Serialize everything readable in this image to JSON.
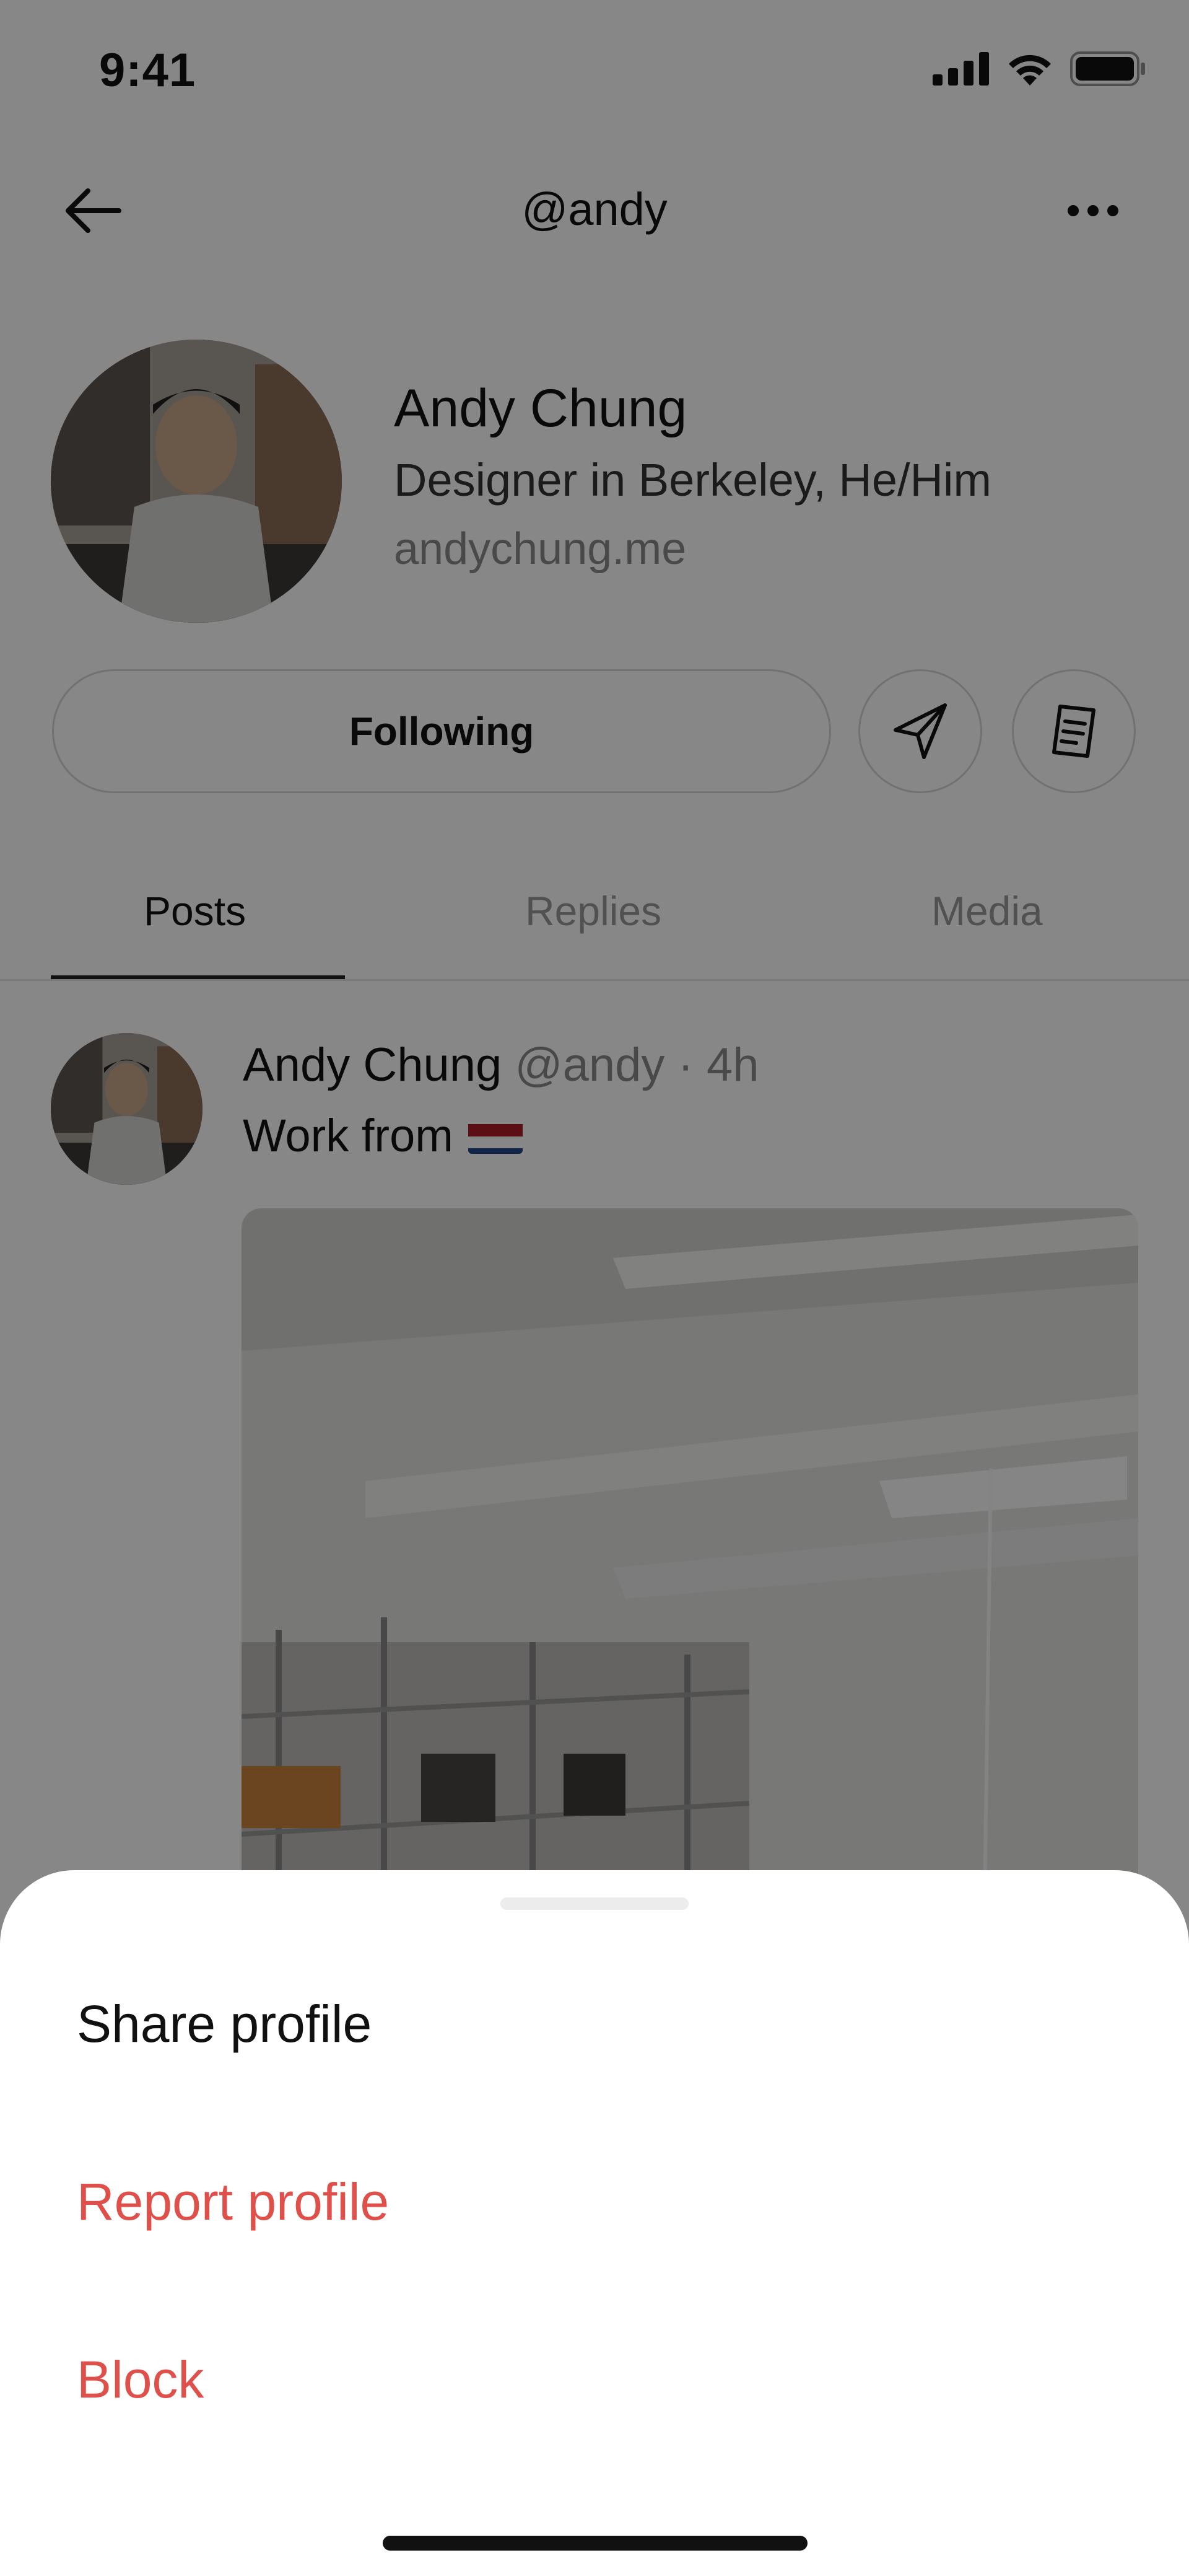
{
  "status_bar": {
    "time": "9:41"
  },
  "nav": {
    "title": "@andy"
  },
  "profile": {
    "name": "Andy Chung",
    "bio": "Designer in Berkeley, He/Him",
    "link": "andychung.me",
    "following_label": "Following"
  },
  "tabs": [
    {
      "label": "Posts",
      "active": true
    },
    {
      "label": "Replies",
      "active": false
    },
    {
      "label": "Media",
      "active": false
    }
  ],
  "post": {
    "author": "Andy Chung",
    "handle": "@andy",
    "separator": "·",
    "time": "4h",
    "text": "Work from"
  },
  "sheet": {
    "items": [
      {
        "label": "Share profile",
        "style": "default"
      },
      {
        "label": "Report profile",
        "style": "danger"
      },
      {
        "label": "Block",
        "style": "danger"
      }
    ]
  },
  "colors": {
    "danger": "#e0504b",
    "overlay": "rgba(0,0,0,0.47)"
  }
}
